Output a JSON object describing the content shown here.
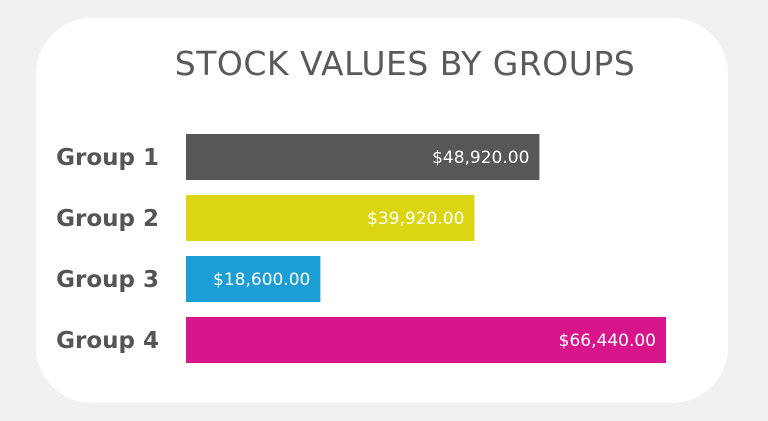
{
  "chart_data": {
    "type": "bar",
    "orientation": "horizontal",
    "title": "STOCK VALUES BY GROUPS",
    "categories": [
      "Group 1",
      "Group 2",
      "Group 3",
      "Group 4"
    ],
    "values": [
      48920,
      39920,
      18600,
      66440
    ],
    "value_labels": [
      "$48,920.00",
      "$39,920.00",
      "$18,600.00",
      "$66,440.00"
    ],
    "colors": [
      "#575757",
      "#dcd512",
      "#1b9dd6",
      "#d8148b"
    ],
    "xlim": [
      0,
      66440
    ],
    "grid": false,
    "legend": "none"
  }
}
